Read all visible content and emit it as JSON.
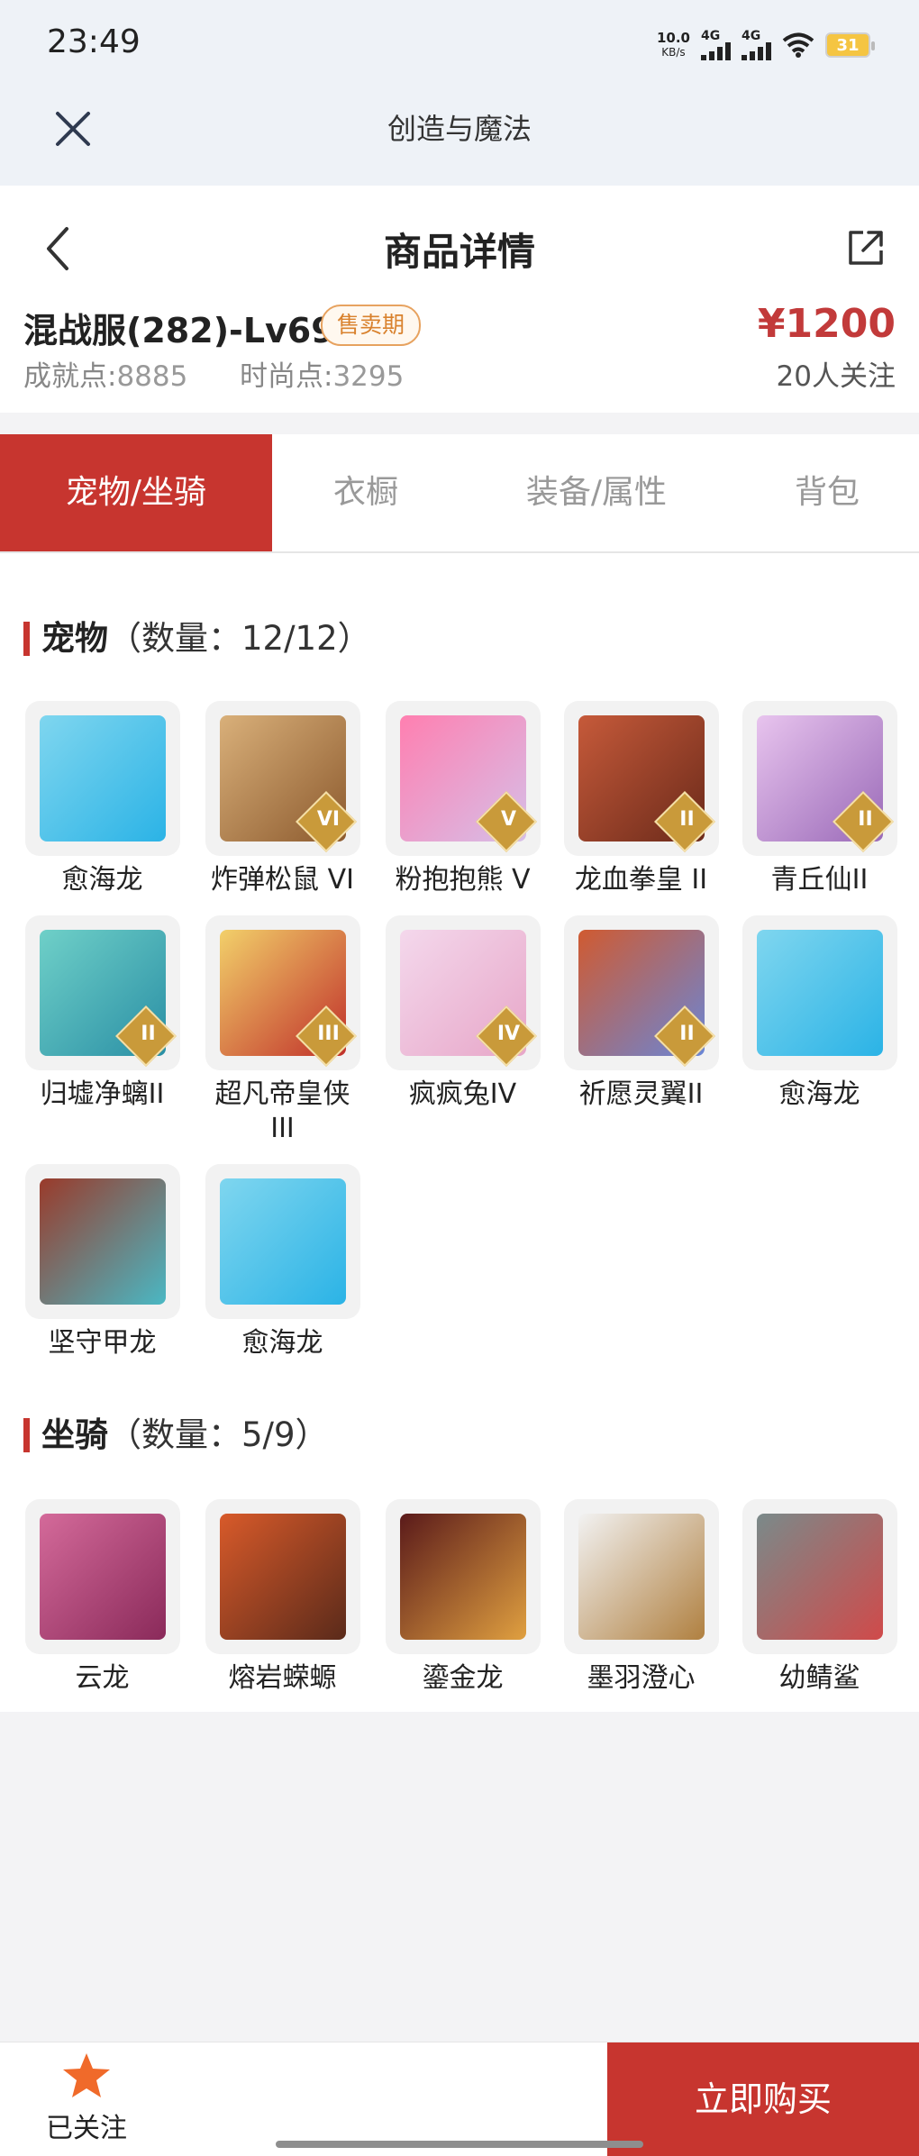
{
  "status_bar": {
    "time": "23:49",
    "net_speed_value": "10.0",
    "net_speed_unit": "KB/s",
    "signal1_label": "4G",
    "signal2_label": "4G",
    "battery": "31"
  },
  "app_bar": {
    "title": "创造与魔法"
  },
  "header": {
    "title": "商品详情",
    "server": "混战服(282)-Lv69",
    "badge": "售卖期",
    "achievement_label": "成就点:",
    "achievement_value": "8885",
    "fashion_label": "时尚点:",
    "fashion_value": "3295",
    "price": "¥1200",
    "followers": "20人关注"
  },
  "tabs": [
    {
      "label": "宠物/坐骑",
      "active": true
    },
    {
      "label": "衣橱",
      "active": false
    },
    {
      "label": "装备/属性",
      "active": false
    },
    {
      "label": "背包",
      "active": false
    }
  ],
  "pets_section": {
    "title": "宠物",
    "count": "（数量：12/12）",
    "items": [
      {
        "name": "愈海龙",
        "rank": "",
        "icon": "sea-dragon-icon"
      },
      {
        "name": "炸弹松鼠 VI",
        "rank": "VI",
        "icon": "bomb-squirrel-icon"
      },
      {
        "name": "粉抱抱熊 V",
        "rank": "V",
        "icon": "pink-bear-icon"
      },
      {
        "name": "龙血拳皇 II",
        "rank": "II",
        "icon": "dragon-boxer-icon"
      },
      {
        "name": "青丘仙II",
        "rank": "II",
        "icon": "fox-fairy-icon"
      },
      {
        "name": "归墟净螭II",
        "rank": "II",
        "icon": "water-dragon-icon"
      },
      {
        "name": "超凡帝皇侠\nIII",
        "rank": "III",
        "icon": "emperor-hero-icon"
      },
      {
        "name": "疯疯兔IV",
        "rank": "IV",
        "icon": "crazy-rabbit-icon"
      },
      {
        "name": "祈愿灵翼II",
        "rank": "II",
        "icon": "spirit-wing-icon"
      },
      {
        "name": "愈海龙",
        "rank": "",
        "icon": "sea-dragon-icon"
      },
      {
        "name": "坚守甲龙",
        "rank": "",
        "icon": "armored-dragon-icon"
      },
      {
        "name": "愈海龙",
        "rank": "",
        "icon": "sea-dragon-icon"
      }
    ]
  },
  "mounts_section": {
    "title": "坐骑",
    "count": "（数量：5/9）",
    "items": [
      {
        "name": "云龙",
        "icon": "cloud-dragon-icon"
      },
      {
        "name": "熔岩蝾螈",
        "icon": "lava-salamander-icon"
      },
      {
        "name": "鎏金龙",
        "icon": "gold-dragon-icon"
      },
      {
        "name": "墨羽澄心",
        "icon": "ink-feather-icon"
      },
      {
        "name": "幼鲭鲨",
        "icon": "shark-icon"
      }
    ]
  },
  "bottom_bar": {
    "follow_label": "已关注",
    "buy_label": "立即购买"
  },
  "colors": {
    "accent": "#c7352f",
    "price": "#c23a3a",
    "badge": "#d9822e",
    "star": "#f06a2a"
  }
}
